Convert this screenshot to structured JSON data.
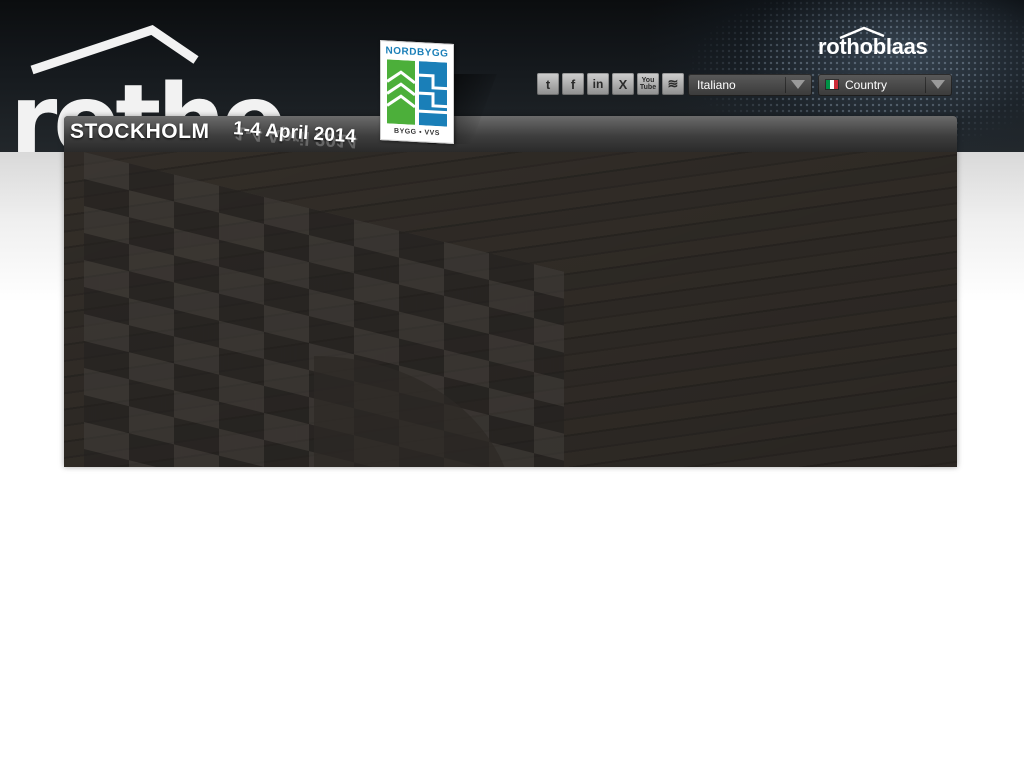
{
  "header": {
    "big_logo_text": "rothe",
    "brand_logo_text": "rothoblaas"
  },
  "event": {
    "city": "STOCKHOLM",
    "dates": "1-4 April 2014",
    "badge_top": "NORDBYGG",
    "badge_bottom": "BYGG • VVS"
  },
  "social": [
    {
      "name": "twitter",
      "glyph": "t"
    },
    {
      "name": "facebook",
      "glyph": "f"
    },
    {
      "name": "linkedin",
      "glyph": "in"
    },
    {
      "name": "xing",
      "glyph": "X"
    },
    {
      "name": "youtube",
      "glyph": "You\nTube"
    },
    {
      "name": "rss",
      "glyph": "≋"
    }
  ],
  "language_select": {
    "value": "Italiano"
  },
  "country_select": {
    "value": "Country",
    "flag_colors": [
      "#009246",
      "#ffffff",
      "#ce2b37"
    ]
  },
  "colors": {
    "header_bg": "#15191d",
    "panel_bg": "#2b2926",
    "badge_blue": "#1a7fb8",
    "badge_green": "#4caf3a"
  }
}
